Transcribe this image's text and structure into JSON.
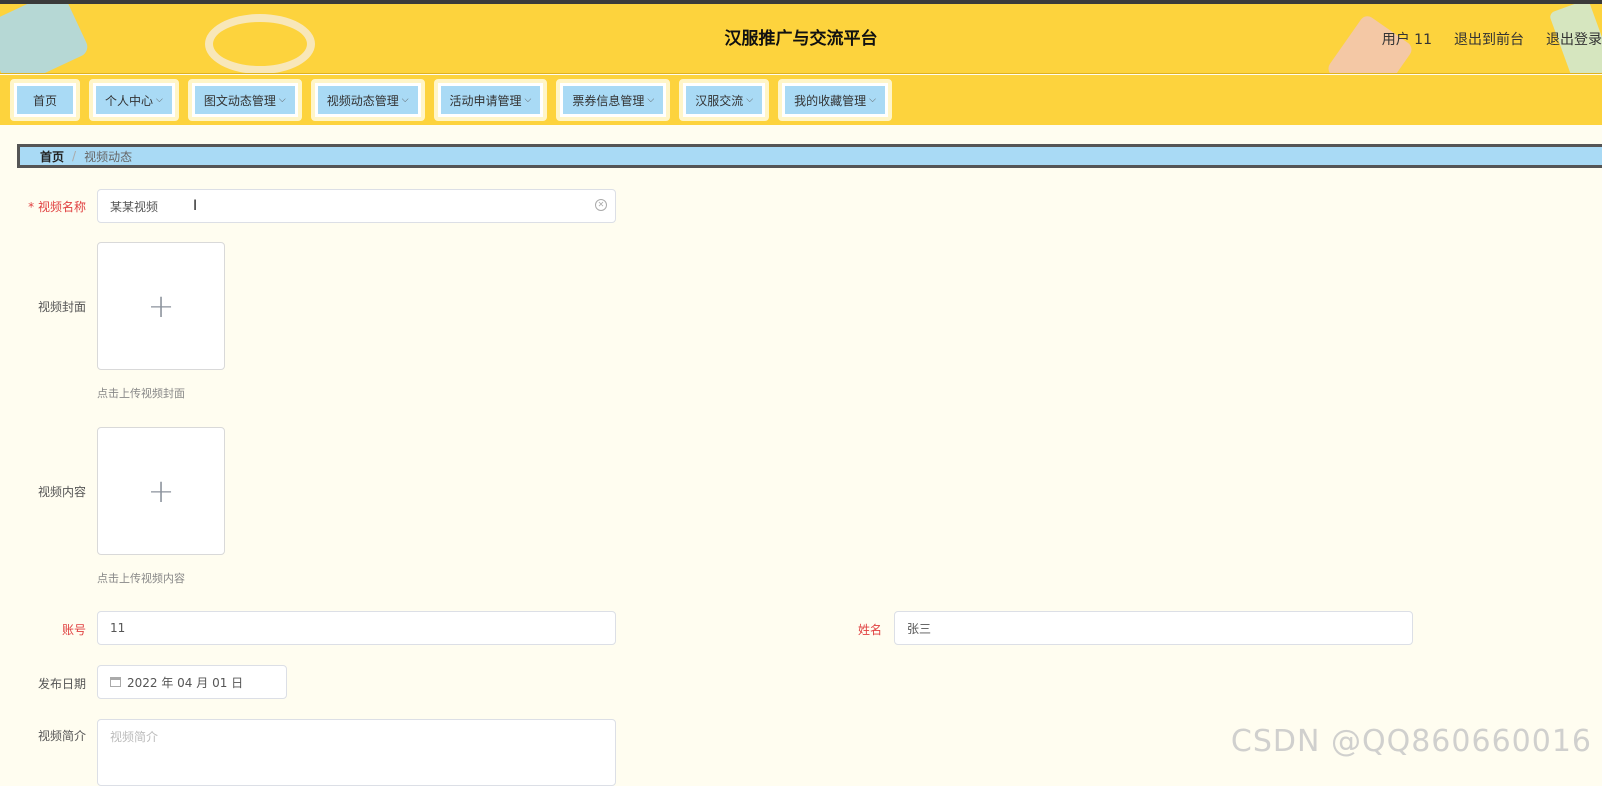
{
  "header": {
    "title": "汉服推广与交流平台",
    "user": "用户 11",
    "back_to_front": "退出到前台",
    "logout": "退出登录"
  },
  "nav": {
    "home": "首页",
    "items": [
      "个人中心",
      "图文动态管理",
      "视频动态管理",
      "活动申请管理",
      "票券信息管理",
      "汉服交流",
      "我的收藏管理"
    ]
  },
  "breadcrumb": {
    "home": "首页",
    "sep": "/",
    "current": "视频动态"
  },
  "form": {
    "name_label": "* 视频名称",
    "name_value": "某某视频",
    "cover_label": "视频封面",
    "cover_tip": "点击上传视频封面",
    "content_label": "视频内容",
    "content_tip": "点击上传视频内容",
    "account_label": "账号",
    "account_value": "11",
    "realname_label": "姓名",
    "realname_value": "张三",
    "date_label": "发布日期",
    "date_value": "2022 年 04 月 01 日",
    "intro_label": "视频简介",
    "intro_placeholder": "视频简介"
  },
  "watermark": "CSDN @QQ860660016",
  "colors": {
    "header_bg": "#fdd33d",
    "nav_tab_bg": "#a9daf5",
    "page_bg": "#fffdf0",
    "required": "#e04040"
  }
}
